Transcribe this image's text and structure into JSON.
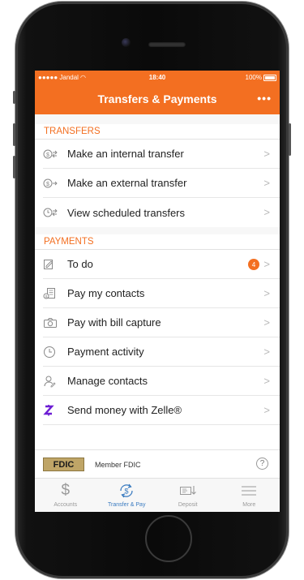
{
  "status_bar": {
    "carrier": "●●●●● Jandal",
    "time": "18:40",
    "battery": "100%"
  },
  "nav": {
    "title": "Transfers & Payments",
    "more_icon": "ellipsis-icon",
    "more_label": "•••"
  },
  "sections": {
    "transfers": {
      "header": "TRANSFERS",
      "items": [
        {
          "label": "Make an internal transfer",
          "icon": "internal-transfer-icon"
        },
        {
          "label": "Make an external transfer",
          "icon": "external-transfer-icon"
        },
        {
          "label": "View scheduled transfers",
          "icon": "scheduled-transfer-icon"
        }
      ]
    },
    "payments": {
      "header": "PAYMENTS",
      "items": [
        {
          "label": "To do",
          "icon": "todo-icon",
          "badge": "4"
        },
        {
          "label": "Pay my contacts",
          "icon": "pay-contacts-icon"
        },
        {
          "label": "Pay with bill capture",
          "icon": "camera-icon"
        },
        {
          "label": "Payment activity",
          "icon": "clock-icon"
        },
        {
          "label": "Manage contacts",
          "icon": "contact-icon"
        },
        {
          "label": "Send money with Zelle®",
          "icon": "zelle-icon"
        }
      ]
    }
  },
  "chevron": ">",
  "footer": {
    "fdic_logo": "FDIC",
    "fdic_text": "Member FDIC",
    "help": "?"
  },
  "tabs": [
    {
      "label": "Accounts",
      "icon": "dollar-icon",
      "active": false
    },
    {
      "label": "Transfer & Pay",
      "icon": "transfer-pay-icon",
      "active": true
    },
    {
      "label": "Deposit",
      "icon": "deposit-icon",
      "active": false
    },
    {
      "label": "More",
      "icon": "menu-icon",
      "active": false
    }
  ],
  "colors": {
    "brand": "#f36f21",
    "active_tab": "#3a7bc0",
    "zelle": "#6d1ed4"
  }
}
